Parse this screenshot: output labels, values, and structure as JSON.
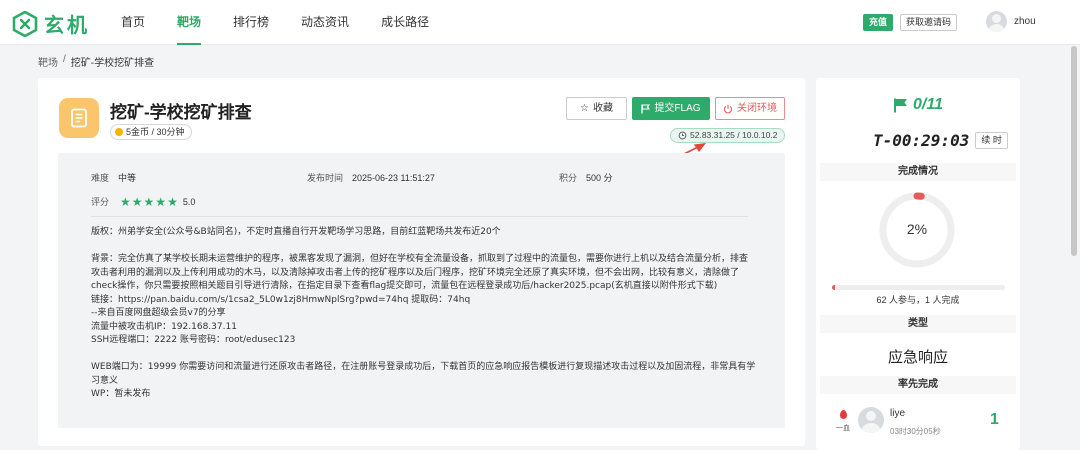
{
  "brand": {
    "name": "玄机",
    "accent": "#2eaa6b"
  },
  "nav": {
    "items": [
      {
        "label": "首页",
        "active": false
      },
      {
        "label": "靶场",
        "active": true
      },
      {
        "label": "排行榜",
        "active": false
      },
      {
        "label": "动态资讯",
        "active": false
      },
      {
        "label": "成长路径",
        "active": false
      }
    ],
    "recharge": "充值",
    "invite": "获取邀请码",
    "username": "zhou"
  },
  "breadcrumb": {
    "root": "靶场",
    "separator": "/",
    "current": "挖矿-学校挖矿排查"
  },
  "challenge": {
    "title": "挖矿-学校挖矿排查",
    "cost": "5金币 / 30分钟",
    "icon": "notebook-icon",
    "buttons": {
      "favorite": "收藏",
      "submit_flag": "提交FLAG",
      "close_env": "关闭环境"
    },
    "ip": "52.83.31.25 / 10.0.10.2",
    "difficulty_label": "难度",
    "difficulty": "中等",
    "publish_label": "发布时间",
    "publish_time": "2025-06-23 11:51:27",
    "points_label": "积分",
    "points": "500 分",
    "rating_label": "评分",
    "rating": "5.0",
    "rating_stars": 5,
    "description": {
      "copyright": "版权：州弟学安全(公众号&B站同名)，不定时直播自行开发靶场学习思路，目前红蓝靶场共发布近20个",
      "background": "背景：完全仿真了某学校长期未运营维护的程序，被黑客发现了漏洞，但好在学校有全流量设备，抓取到了过程中的流量包，需要你进行上机以及结合流量分析，排查攻击者利用的漏洞以及上传利用成功的木马，以及清除掉攻击者上传的挖矿程序以及后门程序，挖矿环境完全还原了真实环境，但不会出网，比较有意义，清除做了check操作，你只需要按照相关题目引导进行清除，在指定目录下查看flag提交即可，流量包在远程登录成功后/hacker2025.pcap(玄机直接以附件形式下载)",
      "link": "链接：https://pan.baidu.com/s/1csa2_5L0w1zj8HmwNplSrg?pwd=74hq 提取码：74hq",
      "share": "--来自百度网盘超级会员v7的分享",
      "attacker_ip": "流量中被攻击机IP：192.168.37.11",
      "ssh": "SSH远程端口：2222 账号密码：root/edusec123",
      "web": "WEB端口为：19999 你需要访问和流量进行还原攻击者路径，在注册账号登录成功后，下载首页的应急响应报告模板进行复现描述攻击过程以及加固流程，非常具有学习意义",
      "wp": "WP：暂未发布"
    }
  },
  "side": {
    "solved": "0/11",
    "timer": "T-00:29:03",
    "extend": "续 时",
    "completion_title": "完成情况",
    "completion_pct": "2%",
    "completion_value": 2,
    "participants": "62 人参与，1 人完成",
    "type_title": "类型",
    "type": "应急响应",
    "first_title": "率先完成",
    "first": {
      "blood_label": "一血",
      "name": "liye",
      "time": "03时30分05秒",
      "rank": "1"
    }
  }
}
